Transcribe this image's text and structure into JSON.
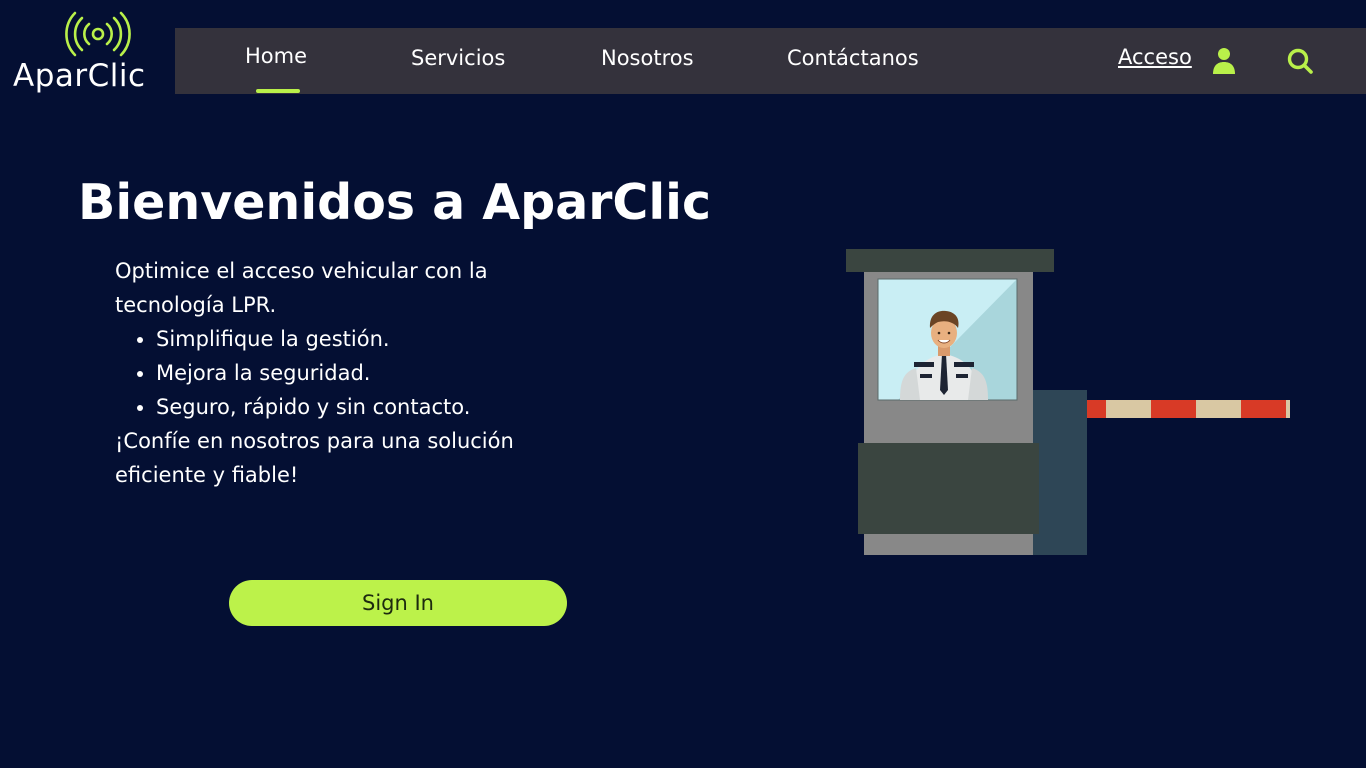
{
  "brand": {
    "name": "AparClic",
    "icon": "signal-broadcast-icon",
    "accent_color": "#b9f04a"
  },
  "nav": {
    "items": [
      {
        "label": "Home",
        "active": true
      },
      {
        "label": "Servicios"
      },
      {
        "label": "Nosotros"
      },
      {
        "label": "Contáctanos"
      }
    ],
    "login_label": "Acceso",
    "login_icon": "user-icon",
    "search_icon": "search-icon"
  },
  "hero": {
    "title": "Bienvenidos a AparClic",
    "intro": "Optimice el acceso vehicular con la tecnología LPR.",
    "bullets": [
      "Simplifique la gestión.",
      "Mejora la seguridad.",
      "Seguro, rápido y sin contacto."
    ],
    "closing": "¡Confíe en nosotros para una solución eficiente y fiable!",
    "cta_label": "Sign In"
  },
  "illustration": {
    "subject": "parking-booth-with-guard-and-barrier"
  },
  "colors": {
    "background": "#040f33",
    "navbar": "#34323c",
    "accent": "#bcf24a"
  }
}
